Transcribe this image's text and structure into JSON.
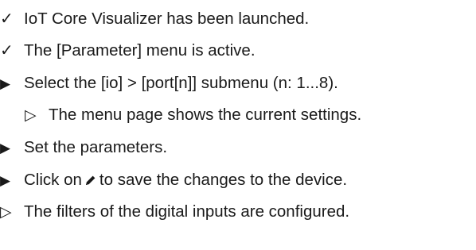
{
  "doc": {
    "prereq_1": "IoT Core Visualizer has been launched.",
    "prereq_2": "The [Parameter] menu is active.",
    "step_1": "Select the [io] > [port[n]] submenu (n: 1...8).",
    "step_1_result": "The menu page shows the current settings.",
    "step_2": "Set the parameters.",
    "step_3_before_icon": "Click on",
    "step_3_icon": "pencil-icon",
    "step_3_after_icon": "to save the changes to the device.",
    "final_result": "The filters of the digital inputs are configured.",
    "markers": {
      "check": "✓",
      "action": "▶",
      "result": "▷"
    }
  }
}
